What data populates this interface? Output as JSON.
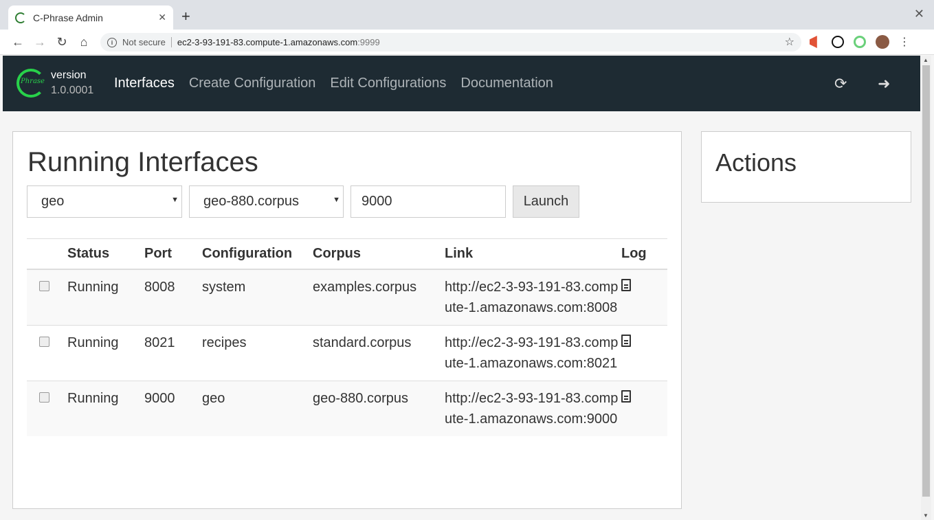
{
  "browser": {
    "tab_title": "C-Phrase Admin",
    "tab_close": "✕",
    "new_tab": "+",
    "window_close": "✕",
    "security_label": "Not secure",
    "url_host": "ec2-3-93-191-83.compute-1.amazonaws.com",
    "url_port": ":9999"
  },
  "navbar": {
    "logo_text": "Phrase",
    "version_label": "version",
    "version_number": "1.0.0001",
    "links": [
      "Interfaces",
      "Create Configuration",
      "Edit Configurations",
      "Documentation"
    ]
  },
  "main": {
    "title": "Running Interfaces",
    "interface_select": "geo",
    "corpus_select": "geo-880.corpus",
    "port_input": "9000",
    "launch_label": "Launch",
    "table": {
      "headers": [
        "",
        "Status",
        "Port",
        "Configuration",
        "Corpus",
        "Link",
        "Log"
      ],
      "rows": [
        {
          "status": "Running",
          "port": "8008",
          "configuration": "system",
          "corpus": "examples.corpus",
          "link": "http://ec2-3-93-191-83.compute-1.amazonaws.com:8008"
        },
        {
          "status": "Running",
          "port": "8021",
          "configuration": "recipes",
          "corpus": "standard.corpus",
          "link": "http://ec2-3-93-191-83.compute-1.amazonaws.com:8021"
        },
        {
          "status": "Running",
          "port": "9000",
          "configuration": "geo",
          "corpus": "geo-880.corpus",
          "link": "http://ec2-3-93-191-83.compute-1.amazonaws.com:9000"
        }
      ]
    }
  },
  "actions": {
    "title": "Actions"
  },
  "colors": {
    "navbar_bg": "#1e2b33",
    "logo_green": "#28d14a"
  }
}
